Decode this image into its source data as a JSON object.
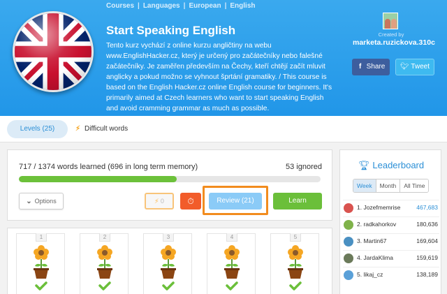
{
  "breadcrumb": [
    "Courses",
    "Languages",
    "European",
    "English"
  ],
  "course": {
    "title": "Start Speaking English",
    "description": "Tento kurz vychází z online kurzu angličtiny na webu www.EnglishHacker.cz, který je určený pro začátečníky nebo falešné začátečníky. Je zaměřen především na Čechy, kteří chtějí začít mluvit anglicky a pokud možno se vyhnout šprtání gramatiky. / This course is based on the English Hacker.cz online English course for beginners. It's primarily aimed at Czech learners who want to start speaking English and avoid cramming grammar as much as possible.",
    "created_by_label": "Created by",
    "creator": "marketa.ruzickova.310c",
    "share_label": "Share",
    "tweet_label": "Tweet"
  },
  "tabs": {
    "levels": "Levels (25)",
    "difficult": "Difficult words"
  },
  "progress": {
    "words_learned": "717 / 1374 words learned (696 in long term memory)",
    "ignored": "53 ignored",
    "fraction": 0.522
  },
  "actions": {
    "options": "Options",
    "difficult_count": "0",
    "review": "Review (21)",
    "learn": "Learn"
  },
  "levels": [
    "1",
    "2",
    "3",
    "4",
    "5"
  ],
  "leaderboard": {
    "title": "Leaderboard",
    "tabs": [
      "Week",
      "Month",
      "All Time"
    ],
    "active_tab": "Week",
    "rows": [
      {
        "name": "1. Jozefmemrise",
        "points": "467,683",
        "color": "#d9534f"
      },
      {
        "name": "2. radkahorkov",
        "points": "180,636",
        "color": "#7fb24a"
      },
      {
        "name": "3. Martin67",
        "points": "169,604",
        "color": "#4a90c2"
      },
      {
        "name": "4. JardaKlima",
        "points": "159,619",
        "color": "#6b7a5a"
      },
      {
        "name": "5. likaj_cz",
        "points": "138,189",
        "color": "#5aa0d8"
      }
    ]
  },
  "colors": {
    "header": "#2b9ceb",
    "accent": "#2b8fd6",
    "learn": "#6bbf3a",
    "review": "#8bcbf7",
    "highlight": "#f28c1e",
    "timer": "#f25c2a"
  }
}
